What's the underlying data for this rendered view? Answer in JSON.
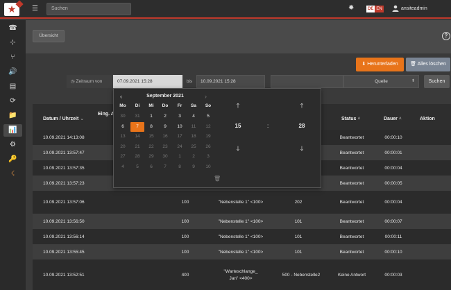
{
  "header": {
    "search_placeholder": "Suchen",
    "lang_de": "DE",
    "lang_en": "EN",
    "username": "ansiteadmin",
    "icons": {
      "menu": "☰",
      "gear": "✹"
    }
  },
  "sidebar": {
    "icons": [
      "☎",
      "⊹",
      "⑂",
      "🔊",
      "▤",
      "⟳",
      "📁",
      "📊",
      "⚙",
      "🔑",
      "☇"
    ]
  },
  "tabs": {
    "overview": "Übersicht"
  },
  "toolbar": {
    "download_label": "Herunterladen",
    "delete_all_label": "Alles löschen"
  },
  "filter": {
    "period_label": "Zeitraum von",
    "from_value": "07.09.2021 15:28",
    "to_label": "bis",
    "to_value": "10.09.2021 15:28",
    "source_label": "Quelle",
    "search_label": "Suchen"
  },
  "table": {
    "headers": {
      "datetime": "Datum / Uhrzeit",
      "incoming": "Eing. A",
      "status": "Status",
      "duration": "Dauer",
      "action": "Aktion"
    },
    "rows": [
      {
        "datetime": "10.09.2021 14:13:08",
        "status": "Beantwortet",
        "duration": "00:00:10"
      },
      {
        "datetime": "10.09.2021 13:57:47",
        "status": "Beantwortet",
        "duration": "00:00:01"
      },
      {
        "datetime": "10.09.2021 13:57:35",
        "status": "Beantwortet",
        "duration": "00:00:04"
      },
      {
        "datetime": "10.09.2021 13:57:23",
        "status": "Beantwortet",
        "duration": "00:00:05"
      },
      {
        "datetime": "10.09.2021 13:57:06",
        "col2": "100",
        "col3": "\"Nebenstelle 1\" <100>",
        "col4": "202",
        "status": "Beantwortet",
        "duration": "00:00:04"
      },
      {
        "datetime": "10.09.2021 13:56:50",
        "col2": "100",
        "col3": "\"Nebenstelle 1\" <100>",
        "col4": "101",
        "status": "Beantwortet",
        "duration": "00:00:07"
      },
      {
        "datetime": "10.09.2021 13:56:14",
        "col2": "100",
        "col3": "\"Nebenstelle 1\" <100>",
        "col4": "101",
        "status": "Beantwortet",
        "duration": "00:00:11"
      },
      {
        "datetime": "10.09.2021 13:55:45",
        "col2": "100",
        "col3": "\"Nebenstelle 1\" <100>",
        "col4": "101",
        "status": "Beantwortet",
        "duration": "00:00:10"
      },
      {
        "datetime": "10.09.2021 13:52:51",
        "col2": "400",
        "col3a": "\"Warteschlange_",
        "col3b": "Jan\" <400>",
        "col4": "500 - Nebenstelle2",
        "status": "Keine Antwort",
        "duration": "00:00:03"
      }
    ]
  },
  "datepicker": {
    "title": "September 2021",
    "weekdays": [
      "Mo",
      "Di",
      "Mi",
      "Do",
      "Fr",
      "Sa",
      "So"
    ],
    "weeks": [
      [
        "30",
        "31",
        "1",
        "2",
        "3",
        "4",
        "5"
      ],
      [
        "6",
        "7",
        "8",
        "9",
        "10",
        "11",
        "12"
      ],
      [
        "13",
        "14",
        "15",
        "16",
        "17",
        "18",
        "19"
      ],
      [
        "20",
        "21",
        "22",
        "23",
        "24",
        "25",
        "26"
      ],
      [
        "27",
        "28",
        "29",
        "30",
        "1",
        "2",
        "3"
      ],
      [
        "4",
        "5",
        "6",
        "7",
        "8",
        "9",
        "10"
      ]
    ],
    "hour": "15",
    "minute": "28",
    "separator": ":",
    "selected_day": "7"
  },
  "colors": {
    "accent": "#e8741a",
    "brand_red": "#c0392b",
    "secondary_button": "#7a8594"
  }
}
